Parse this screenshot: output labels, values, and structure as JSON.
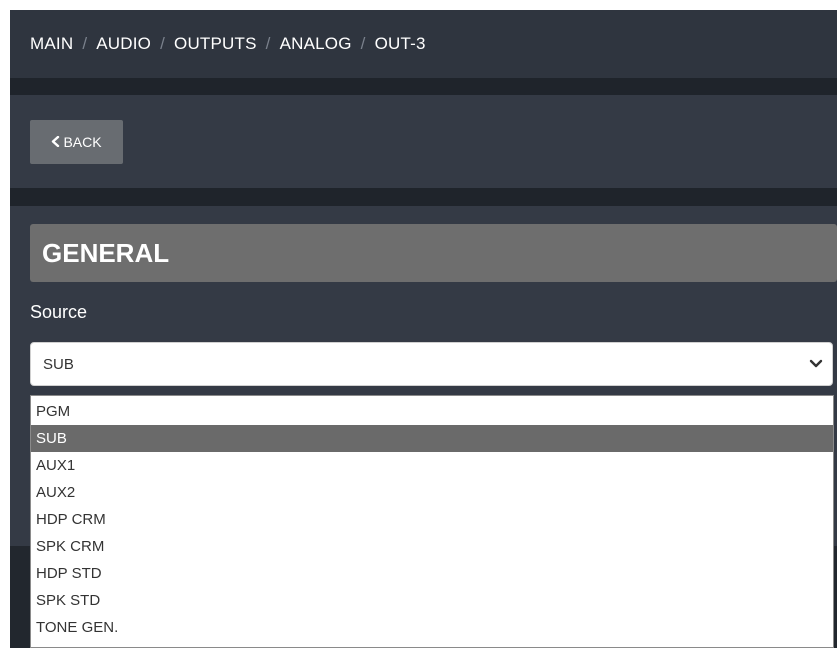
{
  "breadcrumb": {
    "items": [
      "MAIN",
      "AUDIO",
      "OUTPUTS",
      "ANALOG"
    ],
    "current": "OUT-3",
    "separator": "/"
  },
  "toolbar": {
    "back_label": "BACK"
  },
  "general": {
    "title": "GENERAL",
    "source_label": "Source",
    "source_value": "SUB",
    "options": [
      "PGM",
      "SUB",
      "AUX1",
      "AUX2",
      "HDP CRM",
      "SPK CRM",
      "HDP STD",
      "SPK STD",
      "TONE GEN."
    ],
    "selected_option": "SUB"
  },
  "colors": {
    "panel": "#343a45",
    "breadcrumb_bar": "#2f353f",
    "header_bg": "#6e6e6e",
    "selected_option_bg": "#6a6a6a"
  }
}
